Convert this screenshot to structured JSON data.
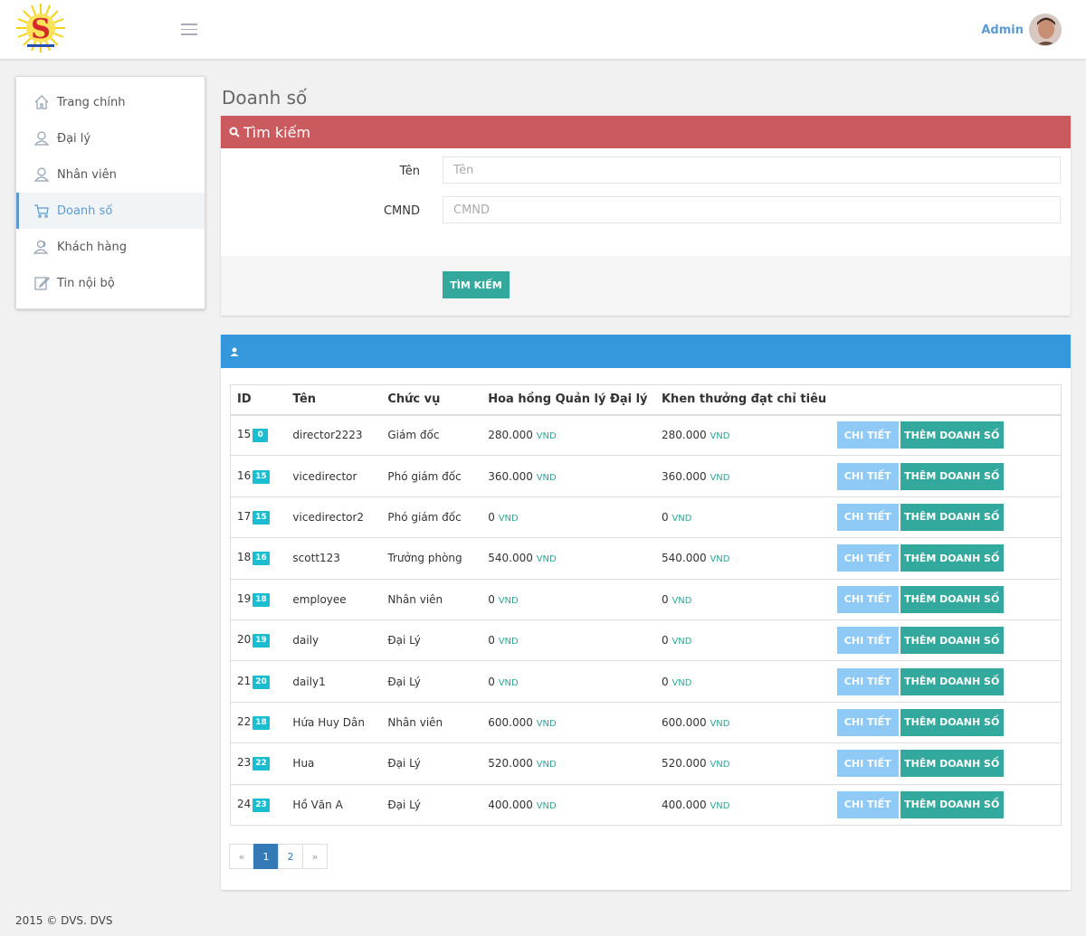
{
  "header": {
    "admin_label": "Admin"
  },
  "sidebar": {
    "items": [
      {
        "label": "Trang chính",
        "icon": "home-icon"
      },
      {
        "label": "Đại lý",
        "icon": "user-icon"
      },
      {
        "label": "Nhân viên",
        "icon": "user-icon"
      },
      {
        "label": "Doanh số",
        "icon": "cart-icon",
        "active": true
      },
      {
        "label": "Khách hàng",
        "icon": "users-icon"
      },
      {
        "label": "Tin nội bộ",
        "icon": "edit-icon"
      }
    ]
  },
  "page": {
    "title": "Doanh số"
  },
  "search": {
    "title": "Tìm kiếm",
    "name_label": "Tên",
    "name_placeholder": "Tên",
    "id_label": "CMND",
    "id_placeholder": "CMND",
    "submit_label": "TÌM KIẾM"
  },
  "table": {
    "headers": [
      "ID",
      "Tên",
      "Chức vụ",
      "Hoa hồng Quản lý Đại lý",
      "Khen thưởng đạt chỉ tiêu"
    ],
    "currency": "VND",
    "detail_label": "CHI TIẾT",
    "add_label": "THÊM DOANH SỐ",
    "rows": [
      {
        "id": "15",
        "badge": "0",
        "name": "director2223",
        "position": "Giám đốc",
        "commission": "280.000",
        "bonus": "280.000"
      },
      {
        "id": "16",
        "badge": "15",
        "name": "vicedirector",
        "position": "Phó giám đốc",
        "commission": "360.000",
        "bonus": "360.000"
      },
      {
        "id": "17",
        "badge": "15",
        "name": "vicedirector2",
        "position": "Phó giám đốc",
        "commission": "0",
        "bonus": "0"
      },
      {
        "id": "18",
        "badge": "16",
        "name": "scott123",
        "position": "Trưởng phòng",
        "commission": "540.000",
        "bonus": "540.000"
      },
      {
        "id": "19",
        "badge": "18",
        "name": "employee",
        "position": "Nhân viên",
        "commission": "0",
        "bonus": "0"
      },
      {
        "id": "20",
        "badge": "19",
        "name": "daily",
        "position": "Đại Lý",
        "commission": "0",
        "bonus": "0"
      },
      {
        "id": "21",
        "badge": "20",
        "name": "daily1",
        "position": "Đại Lý",
        "commission": "0",
        "bonus": "0"
      },
      {
        "id": "22",
        "badge": "18",
        "name": "Hứa Huy Dân",
        "position": "Nhân viên",
        "commission": "600.000",
        "bonus": "600.000"
      },
      {
        "id": "23",
        "badge": "22",
        "name": "Hua",
        "position": "Đại Lý",
        "commission": "520.000",
        "bonus": "520.000"
      },
      {
        "id": "24",
        "badge": "23",
        "name": "Hồ Văn A",
        "position": "Đại Lý",
        "commission": "400.000",
        "bonus": "400.000"
      }
    ]
  },
  "pagination": {
    "prev": "«",
    "pages": [
      "1",
      "2"
    ],
    "current": "1",
    "next": "»"
  },
  "footer": {
    "text": "2015 © DVS. DVS"
  },
  "colors": {
    "search_header": "#cb5a5e",
    "list_header": "#3598dc",
    "primary_button": "#32a99c",
    "detail_button": "#8fc9f5",
    "badge": "#1bbdd0",
    "link": "#5b9bd1"
  }
}
